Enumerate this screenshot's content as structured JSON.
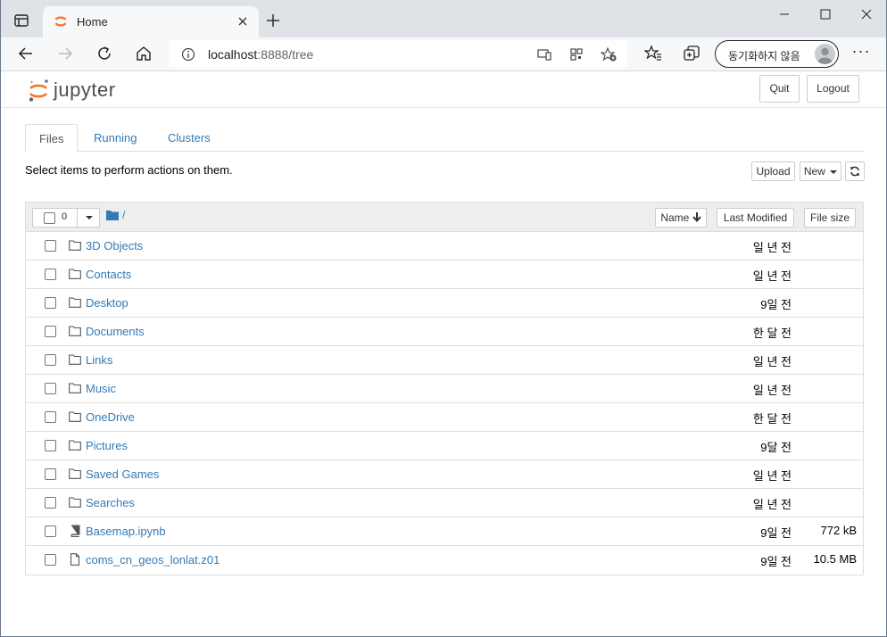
{
  "browser": {
    "tab_title": "Home",
    "url_host": "localhost",
    "url_rest": ":8888/tree",
    "profile_label": "동기화하지 않음",
    "more_label": "···"
  },
  "header": {
    "logo_text": "jupyter",
    "quit_label": "Quit",
    "logout_label": "Logout"
  },
  "tabs": [
    {
      "label": "Files"
    },
    {
      "label": "Running"
    },
    {
      "label": "Clusters"
    }
  ],
  "toolbar": {
    "help_text": "Select items to perform actions on them.",
    "upload_label": "Upload",
    "new_label": "New"
  },
  "list": {
    "selected_count": "0",
    "breadcrumb": "/",
    "sort_name": "Name",
    "sort_modified": "Last Modified",
    "sort_size": "File size",
    "items": [
      {
        "name": "3D Objects",
        "type": "folder",
        "modified": "일 년 전",
        "size": ""
      },
      {
        "name": "Contacts",
        "type": "folder",
        "modified": "일 년 전",
        "size": ""
      },
      {
        "name": "Desktop",
        "type": "folder",
        "modified": "9일 전",
        "size": ""
      },
      {
        "name": "Documents",
        "type": "folder",
        "modified": "한 달 전",
        "size": ""
      },
      {
        "name": "Links",
        "type": "folder",
        "modified": "일 년 전",
        "size": ""
      },
      {
        "name": "Music",
        "type": "folder",
        "modified": "일 년 전",
        "size": ""
      },
      {
        "name": "OneDrive",
        "type": "folder",
        "modified": "한 달 전",
        "size": ""
      },
      {
        "name": "Pictures",
        "type": "folder",
        "modified": "9달 전",
        "size": ""
      },
      {
        "name": "Saved Games",
        "type": "folder",
        "modified": "일 년 전",
        "size": ""
      },
      {
        "name": "Searches",
        "type": "folder",
        "modified": "일 년 전",
        "size": ""
      },
      {
        "name": "Basemap.ipynb",
        "type": "notebook",
        "modified": "9일 전",
        "size": "772 kB"
      },
      {
        "name": "coms_cn_geos_lonlat.z01",
        "type": "file",
        "modified": "9일 전",
        "size": "10.5 MB"
      }
    ]
  },
  "colors": {
    "link": "#337ab7",
    "jupyter_orange": "#f37726"
  }
}
